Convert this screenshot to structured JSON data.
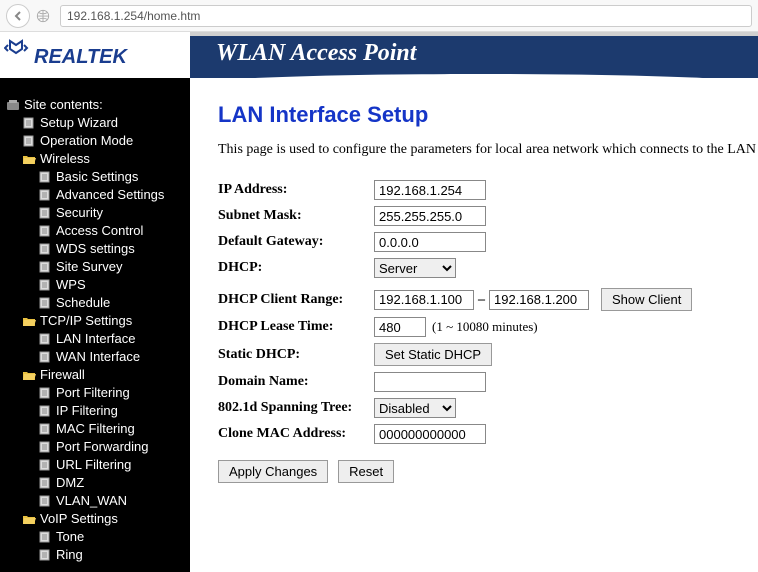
{
  "browser": {
    "url": "192.168.1.254/home.htm"
  },
  "logo_text": "REALTEK",
  "title_bar": "WLAN Access Point",
  "sidebar": {
    "header": "Site contents:",
    "items": [
      {
        "label": "Setup Wizard",
        "level": 1,
        "type": "page"
      },
      {
        "label": "Operation Mode",
        "level": 1,
        "type": "page"
      },
      {
        "label": "Wireless",
        "level": 1,
        "type": "folder-open"
      },
      {
        "label": "Basic Settings",
        "level": 2,
        "type": "page"
      },
      {
        "label": "Advanced Settings",
        "level": 2,
        "type": "page"
      },
      {
        "label": "Security",
        "level": 2,
        "type": "page"
      },
      {
        "label": "Access Control",
        "level": 2,
        "type": "page"
      },
      {
        "label": "WDS settings",
        "level": 2,
        "type": "page"
      },
      {
        "label": "Site Survey",
        "level": 2,
        "type": "page"
      },
      {
        "label": "WPS",
        "level": 2,
        "type": "page"
      },
      {
        "label": "Schedule",
        "level": 2,
        "type": "page"
      },
      {
        "label": "TCP/IP Settings",
        "level": 1,
        "type": "folder-open"
      },
      {
        "label": "LAN Interface",
        "level": 2,
        "type": "page"
      },
      {
        "label": "WAN Interface",
        "level": 2,
        "type": "page"
      },
      {
        "label": "Firewall",
        "level": 1,
        "type": "folder-open"
      },
      {
        "label": "Port Filtering",
        "level": 2,
        "type": "page"
      },
      {
        "label": "IP Filtering",
        "level": 2,
        "type": "page"
      },
      {
        "label": "MAC Filtering",
        "level": 2,
        "type": "page"
      },
      {
        "label": "Port Forwarding",
        "level": 2,
        "type": "page"
      },
      {
        "label": "URL Filtering",
        "level": 2,
        "type": "page"
      },
      {
        "label": "DMZ",
        "level": 2,
        "type": "page"
      },
      {
        "label": "VLAN_WAN",
        "level": 2,
        "type": "page"
      },
      {
        "label": "VoIP Settings",
        "level": 1,
        "type": "folder-open"
      },
      {
        "label": "Tone",
        "level": 2,
        "type": "page"
      },
      {
        "label": "Ring",
        "level": 2,
        "type": "page"
      }
    ]
  },
  "page": {
    "heading": "LAN Interface Setup",
    "description": "This page is used to configure the parameters for local area network which connects to the LAN port of",
    "labels": {
      "ip": "IP Address:",
      "mask": "Subnet Mask:",
      "gateway": "Default Gateway:",
      "dhcp": "DHCP:",
      "dhcp_range": "DHCP Client Range:",
      "lease": "DHCP Lease Time:",
      "static_dhcp": "Static DHCP:",
      "domain": "Domain Name:",
      "spanning": "802.1d Spanning Tree:",
      "clone_mac": "Clone MAC Address:"
    },
    "values": {
      "ip": "192.168.1.254",
      "mask": "255.255.255.0",
      "gateway": "0.0.0.0",
      "dhcp": "Server",
      "range_start": "192.168.1.100",
      "range_end": "192.168.1.200",
      "lease": "480",
      "lease_hint": "(1 ~ 10080 minutes)",
      "domain": "",
      "spanning": "Disabled",
      "clone_mac": "000000000000"
    },
    "buttons": {
      "show_client": "Show Client",
      "set_static": "Set Static DHCP",
      "apply": "Apply Changes",
      "reset": "Reset"
    }
  }
}
